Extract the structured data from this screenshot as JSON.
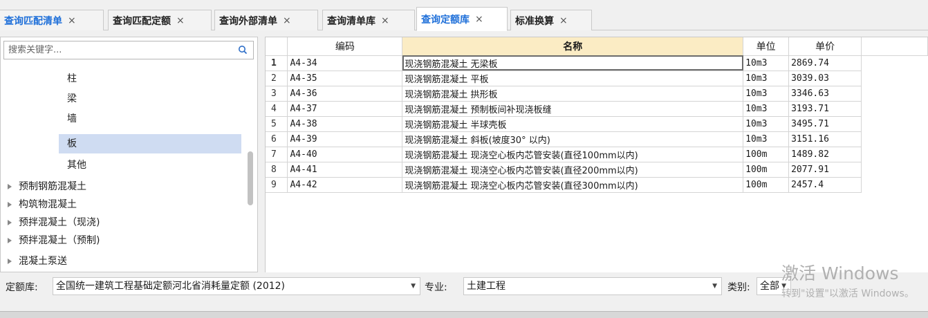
{
  "tabs": [
    {
      "label": "查询匹配清单",
      "close": "×"
    },
    {
      "label": "查询匹配定额",
      "close": "×"
    },
    {
      "label": "查询外部清单",
      "close": "×"
    },
    {
      "label": "查询清单库",
      "close": "×"
    },
    {
      "label": "查询定额库",
      "close": "×"
    },
    {
      "label": "标准换算",
      "close": "×"
    }
  ],
  "search": {
    "placeholder": "搜索关键字..."
  },
  "tree": {
    "leaves": [
      "柱",
      "梁",
      "墙",
      "板",
      "其他"
    ],
    "selected": "板",
    "groups": [
      "预制钢筋混凝土",
      "构筑物混凝土",
      "预拌混凝土（现浇)",
      "预拌混凝土（预制)",
      "混凝土泵送"
    ]
  },
  "grid": {
    "headers": {
      "code": "编码",
      "name": "名称",
      "unit": "单位",
      "price": "单价"
    },
    "rows": [
      {
        "n": "1",
        "code": "A4-34",
        "name": "现浇钢筋混凝土 无梁板",
        "unit": "10m3",
        "price": "2869.74"
      },
      {
        "n": "2",
        "code": "A4-35",
        "name": "现浇钢筋混凝土 平板",
        "unit": "10m3",
        "price": "3039.03"
      },
      {
        "n": "3",
        "code": "A4-36",
        "name": "现浇钢筋混凝土 拱形板",
        "unit": "10m3",
        "price": "3346.63"
      },
      {
        "n": "4",
        "code": "A4-37",
        "name": "现浇钢筋混凝土 预制板间补现浇板缝",
        "unit": "10m3",
        "price": "3193.71"
      },
      {
        "n": "5",
        "code": "A4-38",
        "name": "现浇钢筋混凝土 半球壳板",
        "unit": "10m3",
        "price": "3495.71"
      },
      {
        "n": "6",
        "code": "A4-39",
        "name": "现浇钢筋混凝土 斜板(坡度30° 以内)",
        "unit": "10m3",
        "price": "3151.16"
      },
      {
        "n": "7",
        "code": "A4-40",
        "name": "现浇钢筋混凝土 现浇空心板内芯管安装(直径100mm以内)",
        "unit": "100m",
        "price": "1489.82"
      },
      {
        "n": "8",
        "code": "A4-41",
        "name": "现浇钢筋混凝土 现浇空心板内芯管安装(直径200mm以内)",
        "unit": "100m",
        "price": "2077.91"
      },
      {
        "n": "9",
        "code": "A4-42",
        "name": "现浇钢筋混凝土 现浇空心板内芯管安装(直径300mm以内)",
        "unit": "100m",
        "price": "2457.4"
      }
    ]
  },
  "filter": {
    "quota_label": "定额库:",
    "quota_value": "全国统一建筑工程基础定额河北省消耗量定额 (2012)",
    "major_label": "专业:",
    "major_value": "土建工程",
    "category_label": "类别:",
    "category_value": "全部"
  },
  "watermark": {
    "line1": "激活 Windows",
    "line2": "转到\"设置\"以激活 Windows。"
  },
  "colors": {
    "accent": "#1e6fd9",
    "selection": "#cfdcf2",
    "header_highlight": "#fbecc4"
  }
}
